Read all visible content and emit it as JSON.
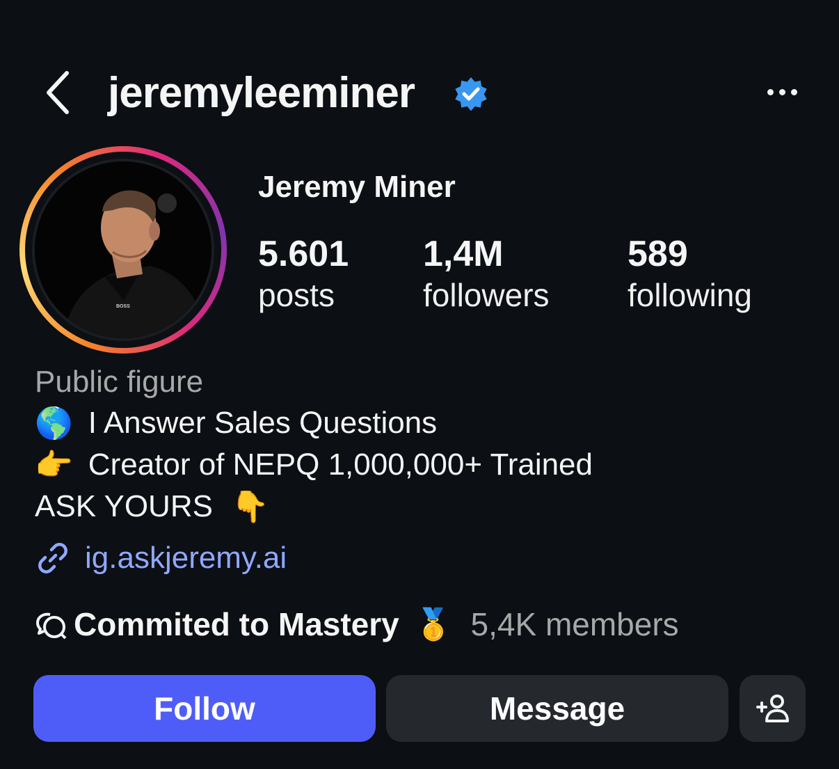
{
  "header": {
    "username": "jeremyleeminer",
    "verified": true,
    "back_icon": "chevron-left-icon",
    "more_icon": "more-horizontal-icon"
  },
  "profile": {
    "display_name": "Jeremy Miner",
    "stats": [
      {
        "value": "5.601",
        "label": "posts"
      },
      {
        "value": "1,4M",
        "label": "followers"
      },
      {
        "value": "589",
        "label": "following"
      }
    ],
    "category": "Public figure",
    "bio": [
      {
        "emoji": "🌎",
        "text": "I Answer Sales Questions"
      },
      {
        "emoji": "👉",
        "text": "Creator of NEPQ 1,000,000+ Trained"
      },
      {
        "emoji": "👇",
        "text": "ASK YOURS"
      }
    ],
    "link": "ig.askjeremy.ai",
    "channel": {
      "name": "Commited to Mastery",
      "emoji": "🥇",
      "members": "5,4K members"
    }
  },
  "actions": {
    "follow": "Follow",
    "message": "Message",
    "add_icon": "add-person-icon"
  },
  "colors": {
    "background": "#0c0f14",
    "follow_button": "#4f5df8",
    "secondary_button": "#25282d",
    "link": "#8fa8ff",
    "verified_badge": "#3897f0"
  }
}
